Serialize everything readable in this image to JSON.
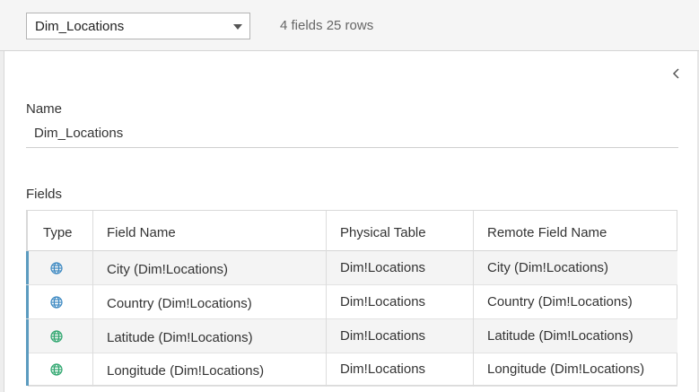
{
  "toolbar": {
    "table_select": "Dim_Locations",
    "summary": "4 fields 25 rows"
  },
  "details": {
    "name_label": "Name",
    "name_value": "Dim_Locations",
    "fields_label": "Fields"
  },
  "grid": {
    "headers": {
      "type": "Type",
      "field_name": "Field Name",
      "physical_table": "Physical Table",
      "remote_field_name": "Remote Field Name"
    },
    "rows": [
      {
        "icon": "globe-icon",
        "icon_color": "#3d89c2",
        "field_name": "City (Dim!Locations)",
        "physical_table": "Dim!Locations",
        "remote_field_name": "City (Dim!Locations)"
      },
      {
        "icon": "globe-icon",
        "icon_color": "#3d89c2",
        "field_name": "Country (Dim!Locations)",
        "physical_table": "Dim!Locations",
        "remote_field_name": "Country (Dim!Locations)"
      },
      {
        "icon": "globe-icon",
        "icon_color": "#2ea66e",
        "field_name": "Latitude (Dim!Locations)",
        "physical_table": "Dim!Locations",
        "remote_field_name": "Latitude (Dim!Locations)"
      },
      {
        "icon": "globe-icon",
        "icon_color": "#2ea66e",
        "field_name": "Longitude (Dim!Locations)",
        "physical_table": "Dim!Locations",
        "remote_field_name": "Longitude (Dim!Locations)"
      }
    ]
  },
  "colors": {
    "row_marker": "#5b9bbf",
    "dimension_icon": "#3d89c2",
    "measure_icon": "#2ea66e"
  }
}
